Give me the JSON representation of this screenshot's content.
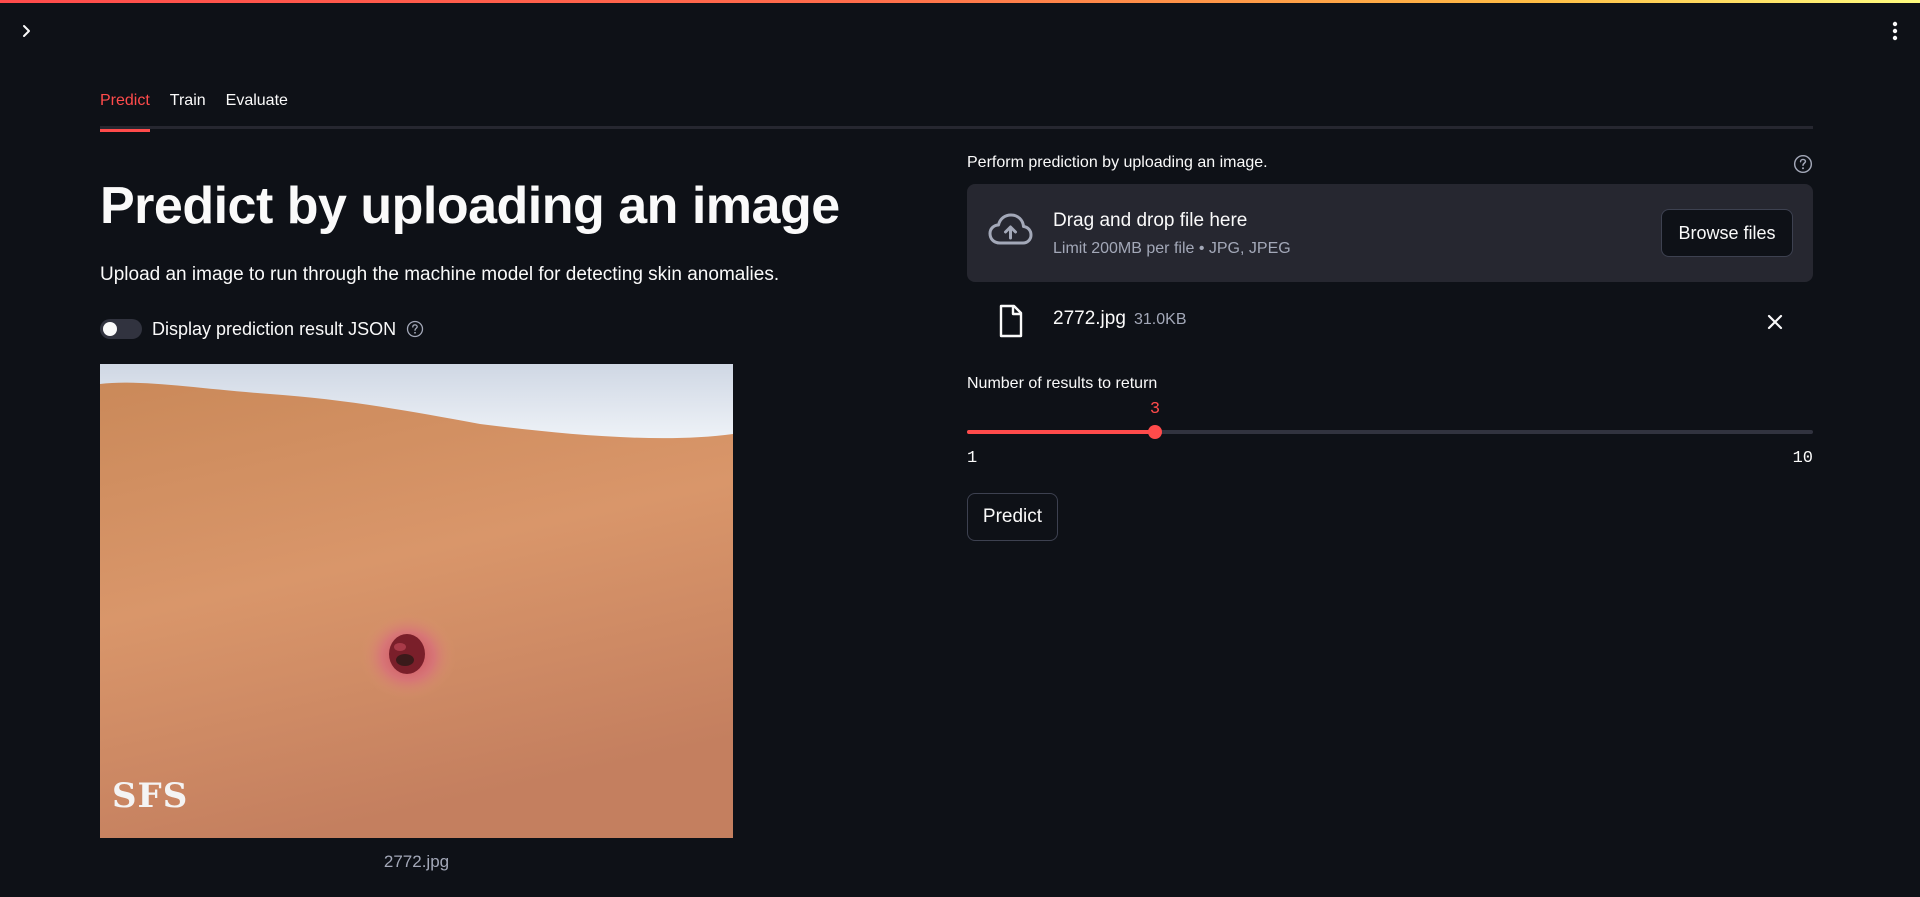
{
  "tabs": [
    {
      "label": "Predict",
      "active": true
    },
    {
      "label": "Train",
      "active": false
    },
    {
      "label": "Evaluate",
      "active": false
    }
  ],
  "left": {
    "title": "Predict by uploading an image",
    "description": "Upload an image to run through the machine model for detecting skin anomalies.",
    "json_toggle": {
      "label": "Display prediction result JSON",
      "checked": false
    },
    "image": {
      "watermark": "SFS",
      "caption": "2772.jpg"
    }
  },
  "uploader": {
    "label": "Perform prediction by uploading an image.",
    "drop_title": "Drag and drop file here",
    "drop_subtitle": "Limit 200MB per file • JPG, JPEG",
    "browse_label": "Browse files",
    "file": {
      "name": "2772.jpg",
      "size": "31.0KB"
    }
  },
  "slider": {
    "label": "Number of results to return",
    "min": 1,
    "max": 10,
    "value": 3,
    "min_label": "1",
    "max_label": "10",
    "value_label": "3"
  },
  "predict_button": "Predict",
  "icons": {
    "sidebar_toggle": "chevron-right-icon",
    "main_menu": "kebab-menu-icon",
    "help": "question-circle-icon",
    "upload": "cloud-upload-icon",
    "file": "file-icon",
    "remove": "close-icon"
  },
  "colors": {
    "background": "#0e1117",
    "accent": "#ff4b4b",
    "panel": "#262730",
    "muted_text": "#a3a8b8"
  }
}
